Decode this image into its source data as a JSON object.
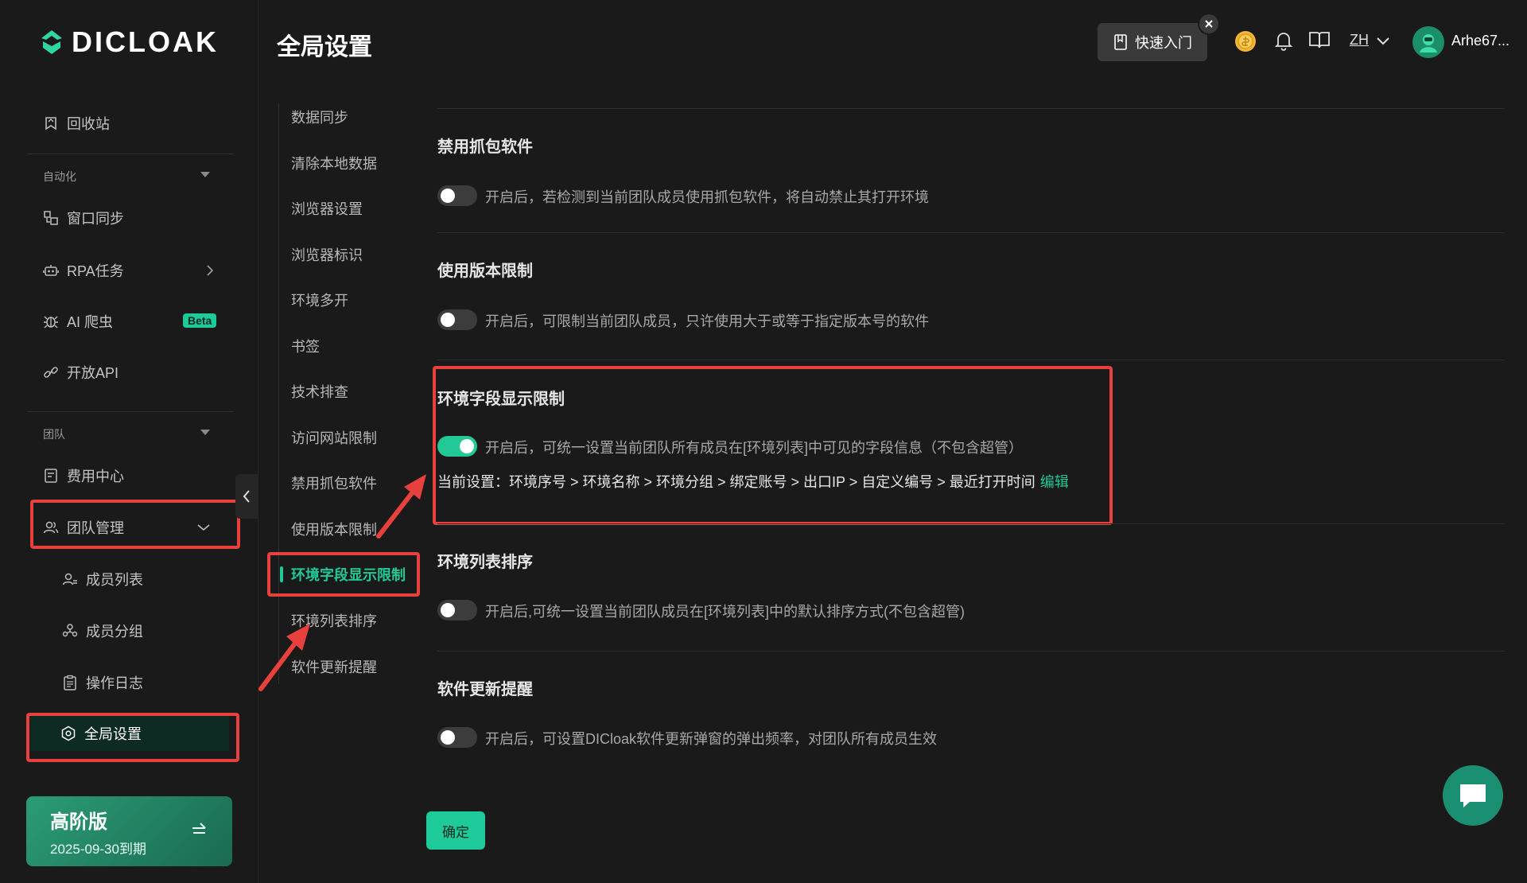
{
  "brand": {
    "name": "DICLOAK"
  },
  "header": {
    "title": "全局设置",
    "quick_start": "快速入门",
    "lang": "ZH",
    "username": "Arhe67..."
  },
  "sidebar": {
    "recycle": "回收站",
    "automation_title": "自动化",
    "window_sync": "窗口同步",
    "rpa": "RPA任务",
    "ai_crawler": "AI 爬虫",
    "beta": "Beta",
    "open_api": "开放API",
    "team_title": "团队",
    "billing": "费用中心",
    "team_mgmt": "团队管理",
    "members": "成员列表",
    "groups": "成员分组",
    "logs": "操作日志",
    "global_settings": "全局设置",
    "plan_name": "高阶版",
    "plan_expiry": "2025-09-30到期"
  },
  "subnav": [
    "数据同步",
    "清除本地数据",
    "浏览器设置",
    "浏览器标识",
    "环境多开",
    "书签",
    "技术排查",
    "访问网站限制",
    "禁用抓包软件",
    "使用版本限制",
    "环境字段显示限制",
    "环境列表排序",
    "软件更新提醒"
  ],
  "settings": {
    "capture": {
      "title": "禁用抓包软件",
      "desc": "开启后，若检测到当前团队成员使用抓包软件，将自动禁止其打开环境",
      "enabled": false
    },
    "version": {
      "title": "使用版本限制",
      "desc": "开启后，可限制当前团队成员，只许使用大于或等于指定版本号的软件",
      "enabled": false
    },
    "fields": {
      "title": "环境字段显示限制",
      "desc": "开启后，可统一设置当前团队所有成员在[环境列表]中可见的字段信息（不包含超管）",
      "enabled": true,
      "current": "当前设置：环境序号 > 环境名称 > 环境分组 > 绑定账号 > 出口IP > 自定义编号 > 最近打开时间",
      "edit": "编辑"
    },
    "sort": {
      "title": "环境列表排序",
      "desc": "开启后,可统一设置当前团队成员在[环境列表]中的默认排序方式(不包含超管)",
      "enabled": false
    },
    "update": {
      "title": "软件更新提醒",
      "desc": "开启后，可设置DICloak软件更新弹窗的弹出频率，对团队所有成员生效",
      "enabled": false
    }
  },
  "confirm": "确定",
  "colors": {
    "accent": "#22c997",
    "highlight": "#e8413d",
    "background": "#1a1a1a"
  }
}
